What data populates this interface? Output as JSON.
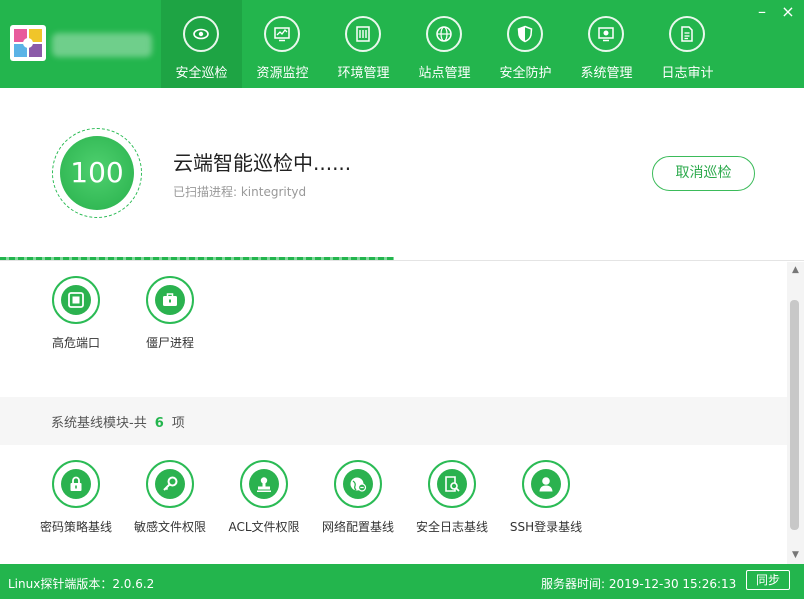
{
  "nav": {
    "tabs": [
      {
        "label": "安全巡检",
        "icon": "patrol-eye-icon",
        "active": true
      },
      {
        "label": "资源监控",
        "icon": "monitor-icon"
      },
      {
        "label": "环境管理",
        "icon": "server-icon"
      },
      {
        "label": "站点管理",
        "icon": "globe-icon"
      },
      {
        "label": "安全防护",
        "icon": "shield-icon"
      },
      {
        "label": "系统管理",
        "icon": "settings-monitor-icon"
      },
      {
        "label": "日志审计",
        "icon": "document-icon"
      }
    ],
    "minimize": "–",
    "close": "×"
  },
  "scan": {
    "score": "100",
    "title": "云端智能巡检中......",
    "subtitle": "已扫描进程: kintegrityd",
    "cancel_label": "取消巡检",
    "progress": 0.49
  },
  "modules_top": [
    {
      "label": "高危端口",
      "icon": "port-icon"
    },
    {
      "label": "僵尸进程",
      "icon": "briefcase-icon"
    }
  ],
  "baseline": {
    "prefix": "系统基线模块-共",
    "count": "6",
    "suffix": "项",
    "items": [
      {
        "label": "密码策略基线",
        "icon": "lock-icon"
      },
      {
        "label": "敏感文件权限",
        "icon": "key-icon"
      },
      {
        "label": "ACL文件权限",
        "icon": "user-stamp-icon"
      },
      {
        "label": "网络配置基线",
        "icon": "network-globe-icon"
      },
      {
        "label": "安全日志基线",
        "icon": "log-search-icon"
      },
      {
        "label": "SSH登录基线",
        "icon": "user-icon"
      }
    ]
  },
  "footer": {
    "version": "Linux探针端版本：2.0.6.2",
    "server_time": "服务器时间:  2019-12-30 15:26:13",
    "sync_label": "同步"
  },
  "colors": {
    "primary": "#23b54d",
    "active_tab": "#1ea444",
    "accent_text": "#2caa4c"
  }
}
